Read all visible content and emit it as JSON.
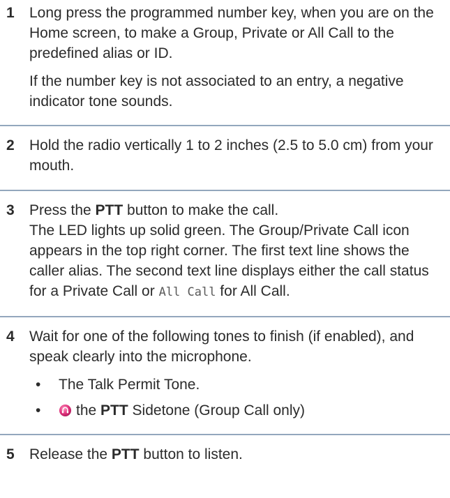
{
  "steps": [
    {
      "number": "1",
      "text": "Long press the programmed number key, when you are on the Home screen, to make a Group, Private or All Call to the predefined alias or ID.",
      "note": "If the number key is not associated to an entry, a negative indicator tone sounds."
    },
    {
      "number": "2",
      "text": "Hold the radio vertically 1 to 2 inches (2.5 to 5.0 cm) from your mouth."
    },
    {
      "number": "3",
      "text_pre": "Press the ",
      "text_bold": "PTT",
      "text_post": " button to make the call.",
      "detail_pre": "The LED lights up solid green. The Group/Private Call icon appears in the top right corner. The first text line shows the caller alias. The second text line displays either the call status for a Private Call or ",
      "detail_mono": "All Call",
      "detail_post": " for All Call."
    },
    {
      "number": "4",
      "text": "Wait for one of the following tones to finish (if enabled), and speak clearly into the microphone.",
      "bullets": [
        {
          "text": "The Talk Permit Tone."
        },
        {
          "pre": "the ",
          "bold": "PTT",
          "post": " Sidetone (Group Call only)",
          "icon": "sidetone-icon"
        }
      ]
    },
    {
      "number": "5",
      "text_pre": "Release the ",
      "text_bold": "PTT",
      "text_post": " button to listen."
    }
  ],
  "colors": {
    "divider": "#93a7bd",
    "icon": "#e0317c"
  }
}
